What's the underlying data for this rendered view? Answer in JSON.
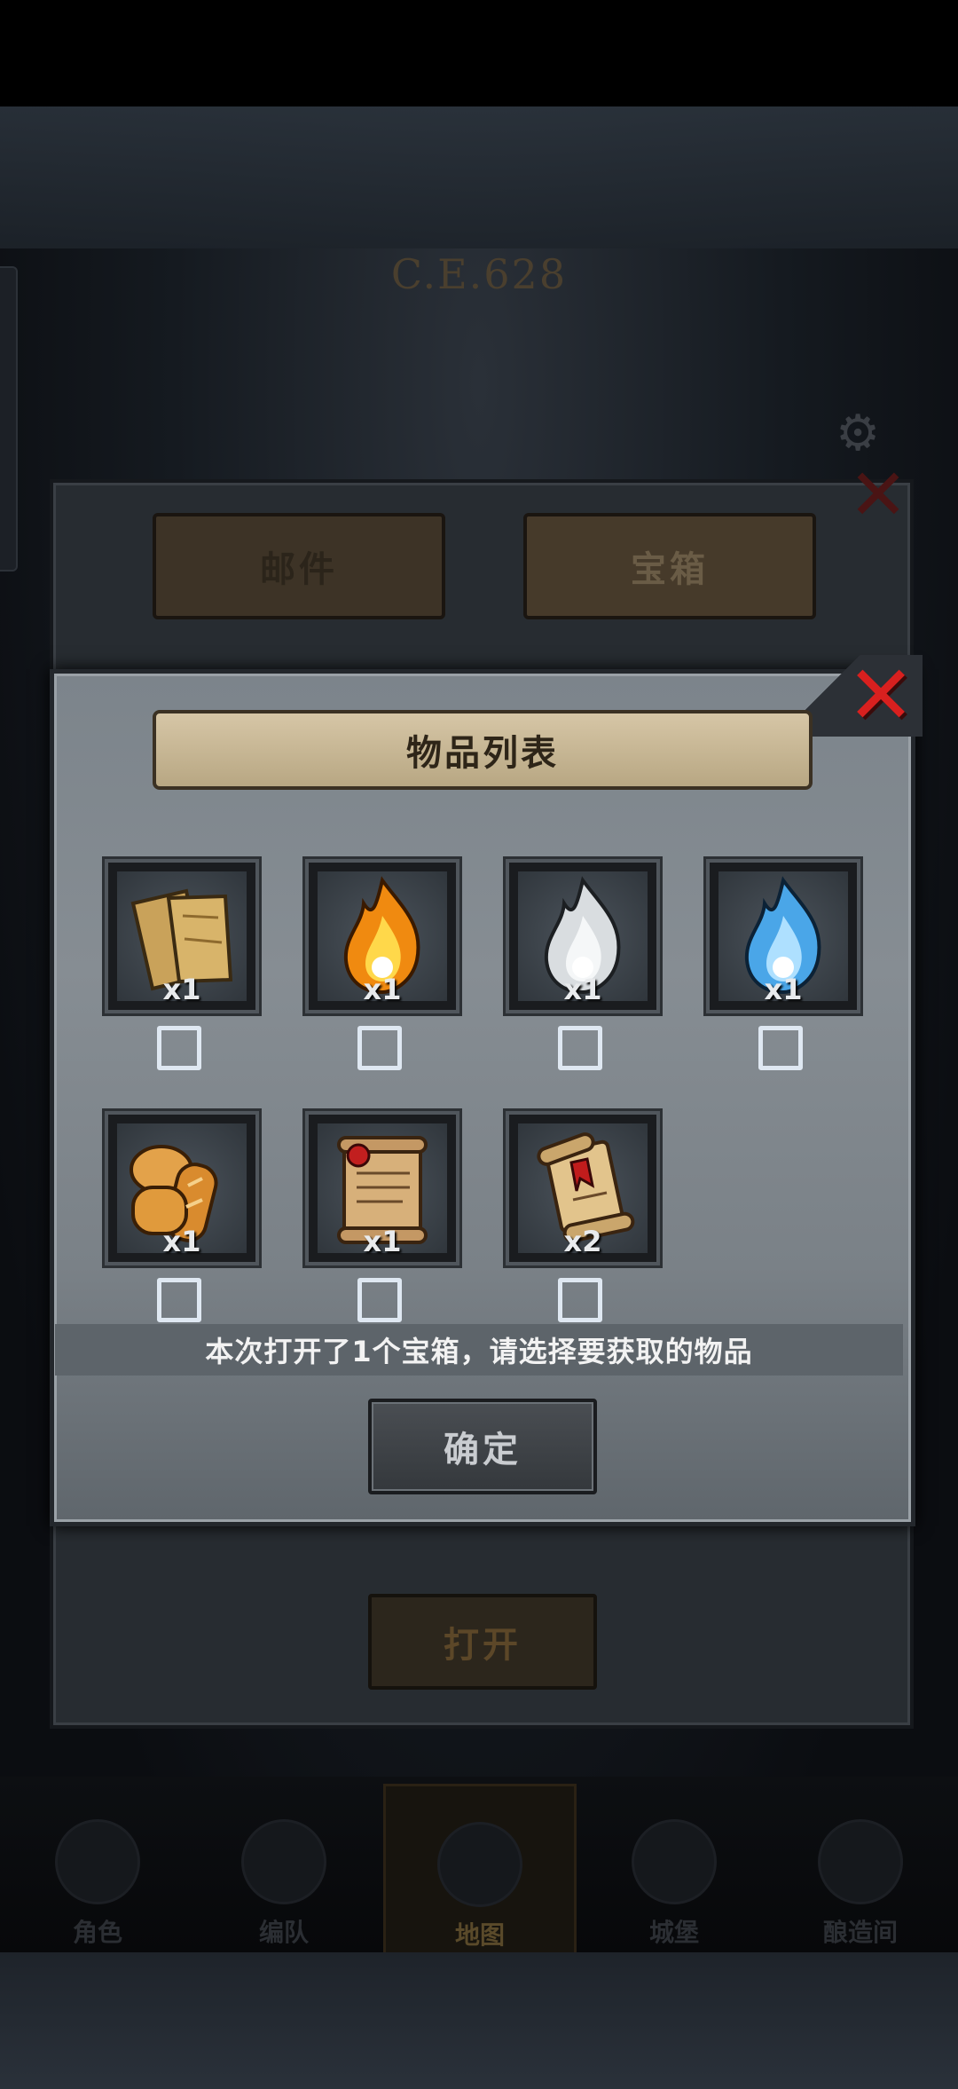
{
  "background": {
    "year_label": "C.E.628",
    "nav": [
      "角色",
      "编队",
      "地图",
      "城堡",
      "酿造间"
    ],
    "active_nav": "地图"
  },
  "back_panel": {
    "tabs": [
      "邮件",
      "宝箱"
    ],
    "active_tab": "宝箱",
    "open_button": "打开"
  },
  "dialog": {
    "title": "物品列表",
    "items": [
      {
        "icon": "map-parchment-icon",
        "qty": "x1",
        "checked": false
      },
      {
        "icon": "orange-flame-icon",
        "qty": "x1",
        "checked": false
      },
      {
        "icon": "white-flame-icon",
        "qty": "x1",
        "checked": false
      },
      {
        "icon": "blue-flame-icon",
        "qty": "x1",
        "checked": false
      },
      {
        "icon": "bread-icon",
        "qty": "x1",
        "checked": false
      },
      {
        "icon": "sealed-scroll-icon",
        "qty": "x1",
        "checked": false
      },
      {
        "icon": "red-scroll-icon",
        "qty": "x2",
        "checked": false
      }
    ],
    "info_text": "本次打开了1个宝箱，请选择要获取的物品",
    "confirm_button": "确定"
  },
  "colors": {
    "close_red": "#d8201f",
    "checkbox": "#dfe8f2",
    "banner": "#d6c6a6"
  }
}
